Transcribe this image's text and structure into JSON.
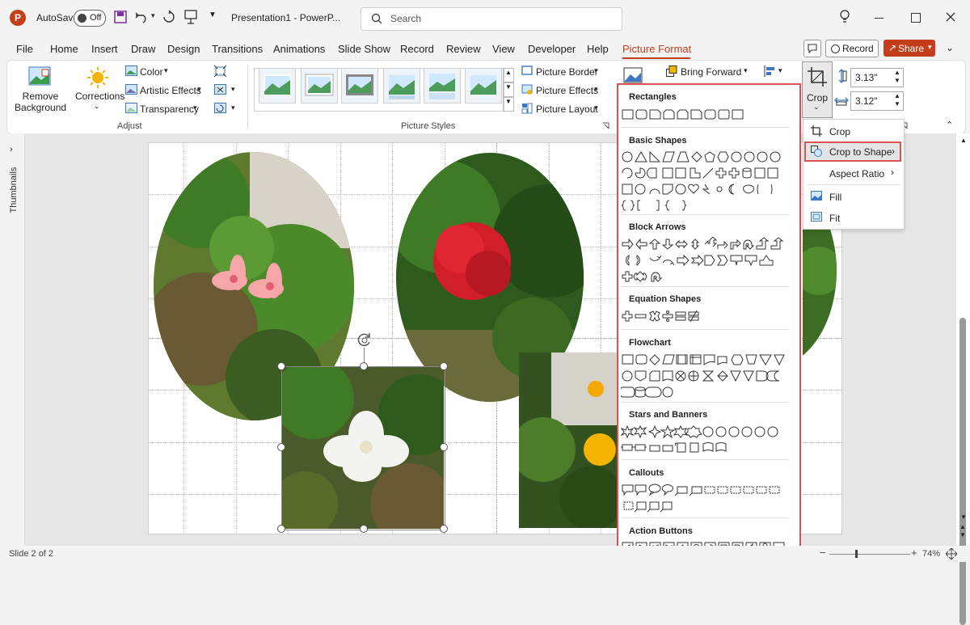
{
  "titlebar": {
    "app_logo": "P",
    "autosave_label": "AutoSave",
    "autosave_state": "Off",
    "doc_title": "Presentation1 - PowerP...",
    "search_placeholder": "Search"
  },
  "tabs": [
    "File",
    "Home",
    "Insert",
    "Draw",
    "Design",
    "Transitions",
    "Animations",
    "Slide Show",
    "Record",
    "Review",
    "View",
    "Developer",
    "Help",
    "Picture Format"
  ],
  "active_tab": "Picture Format",
  "top_right": {
    "record_label": "Record",
    "share_label": "Share"
  },
  "ribbon": {
    "remove_bg": "Remove Background",
    "corrections": "Corrections",
    "color": "Color",
    "artistic": "Artistic Effects",
    "transparency": "Transparency",
    "adjust_label": "Adjust",
    "styles_label": "Picture Styles",
    "picture_border": "Picture Border",
    "picture_effects": "Picture Effects",
    "picture_layout": "Picture Layout",
    "bring_forward": "Bring Forward",
    "crop": "Crop",
    "height": "3.13\"",
    "width": "3.12\""
  },
  "sidebar": {
    "thumbnails": "Thumbnails"
  },
  "gallery": {
    "sections": [
      "Rectangles",
      "Basic Shapes",
      "Block Arrows",
      "Equation Shapes",
      "Flowchart",
      "Stars and Banners",
      "Callouts",
      "Action Buttons"
    ]
  },
  "crop_menu": {
    "items": [
      "Crop",
      "Crop to Shape",
      "Aspect Ratio",
      "Fill",
      "Fit"
    ]
  },
  "status": {
    "slide_info": "Slide 2 of 2",
    "zoom": "74%"
  },
  "colors": {
    "accent": "#c43e1c",
    "highlight": "#d9534f",
    "share": "#c43e1c"
  }
}
